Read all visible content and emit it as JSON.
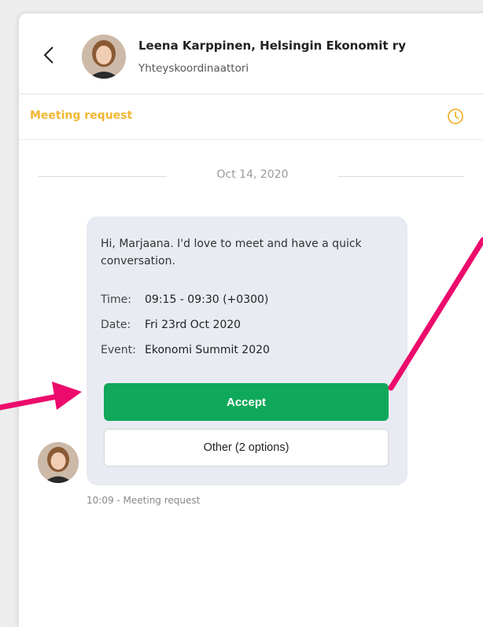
{
  "header": {
    "name": "Leena Karppinen, Helsingin Ekonomit ry",
    "role": "Yhteyskoordinaattori"
  },
  "subbar": {
    "label": "Meeting request",
    "icon": "clock-icon",
    "color": "#f2b632"
  },
  "conversation": {
    "date": "Oct 14, 2020",
    "message": {
      "greeting": "Hi, Marjaana. I'd love to meet and have a quick conversation.",
      "details": [
        {
          "label": "Time:",
          "value": "09:15 - 09:30 (+0300)"
        },
        {
          "label": "Date:",
          "value": "Fri 23rd Oct 2020"
        },
        {
          "label": "Event:",
          "value": "Ekonomi Summit 2020"
        }
      ],
      "accept_label": "Accept",
      "other_label": "Other (2 options)",
      "meta": "10:09 - Meeting request"
    }
  },
  "colors": {
    "accept": "#10a85a",
    "bubble": "#e9ebf3",
    "annotation_arrow": "#ec0b6c"
  }
}
